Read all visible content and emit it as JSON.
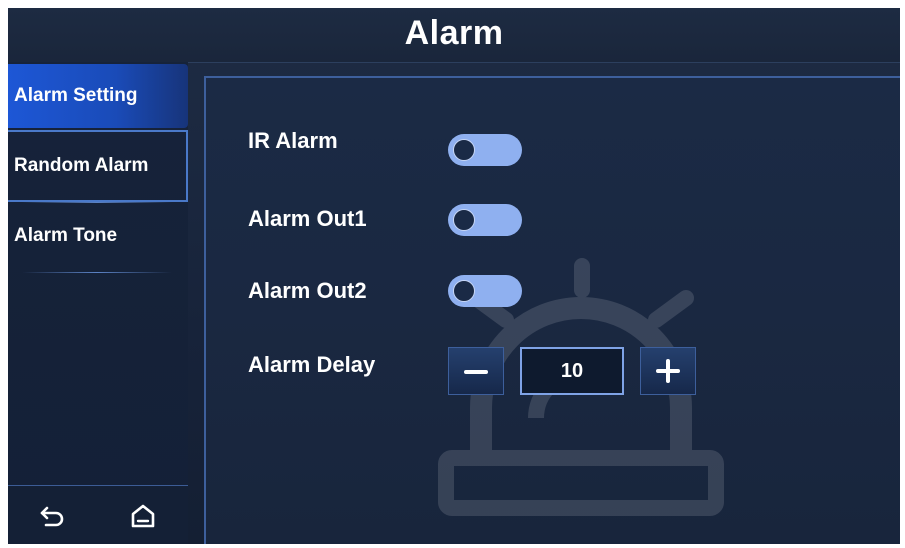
{
  "header": {
    "title": "Alarm"
  },
  "sidebar": {
    "items": [
      {
        "label": "Alarm Setting"
      },
      {
        "label": "Random Alarm"
      },
      {
        "label": "Alarm Tone"
      }
    ]
  },
  "bottom_nav": {
    "back_icon": "back-arrow-icon",
    "home_icon": "home-icon"
  },
  "settings": {
    "ir_alarm": {
      "label": "IR Alarm",
      "enabled": false
    },
    "alarm_out1": {
      "label": "Alarm Out1",
      "enabled": false
    },
    "alarm_out2": {
      "label": "Alarm Out2",
      "enabled": false
    },
    "alarm_delay": {
      "label": "Alarm Delay",
      "value": "10",
      "decrement_icon": "minus-icon",
      "increment_icon": "plus-icon"
    }
  },
  "colors": {
    "accent": "#1d57d6",
    "toggle_track": "#8fb0f0",
    "background": "#17233a"
  }
}
